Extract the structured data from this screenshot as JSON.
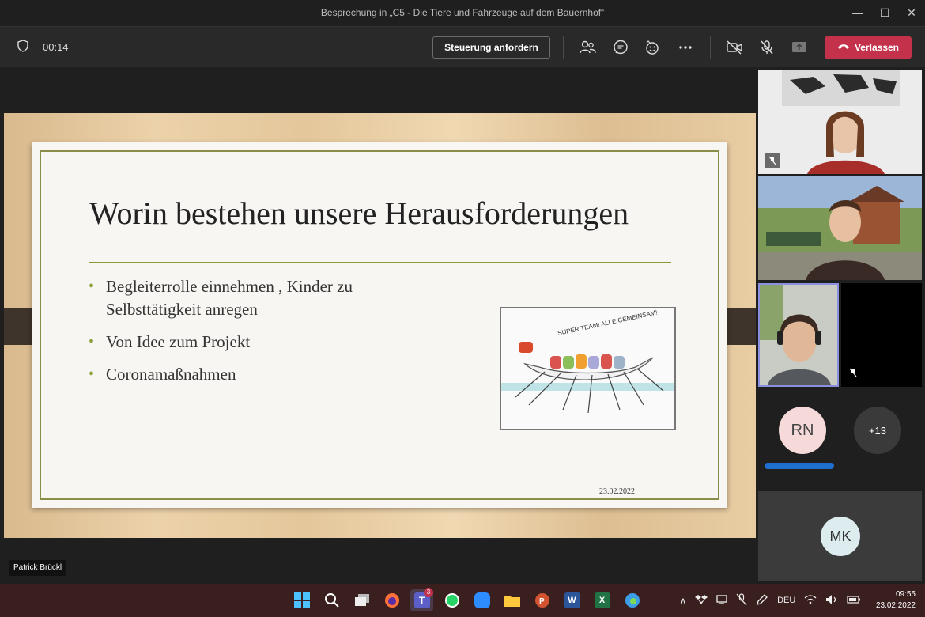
{
  "window": {
    "title": "Besprechung in „C5 - Die Tiere und Fahrzeuge auf dem Bauernhof“",
    "controls": [
      "—",
      "☐",
      "✕"
    ]
  },
  "toolbar": {
    "timer": "00:14",
    "request_control_label": "Steuerung anfordern",
    "leave_label": "Verlassen"
  },
  "slide": {
    "title": "Worin bestehen unsere Herausforderungen",
    "bullets": [
      "Begleiterrolle einnehmen , Kinder zu Selbsttätigkeit anregen",
      "Von Idee zum Projekt",
      "Coronamaßnahmen"
    ],
    "date": "23.02.2022",
    "image_caption": "SUPER TEAM! ALLE GEMEINSAM!"
  },
  "presenter_name": "Patrick Brückl",
  "participants": {
    "rn_initials": "RN",
    "more_count": "+13",
    "mk_initials": "MK"
  },
  "taskbar": {
    "lang": "DEU",
    "time": "09:55",
    "date": "23.02.2022",
    "teams_badge": "3"
  },
  "colors": {
    "leave": "#c4314b",
    "slide_accent": "#8aa13c",
    "taskbar": "#3a1f1f"
  }
}
